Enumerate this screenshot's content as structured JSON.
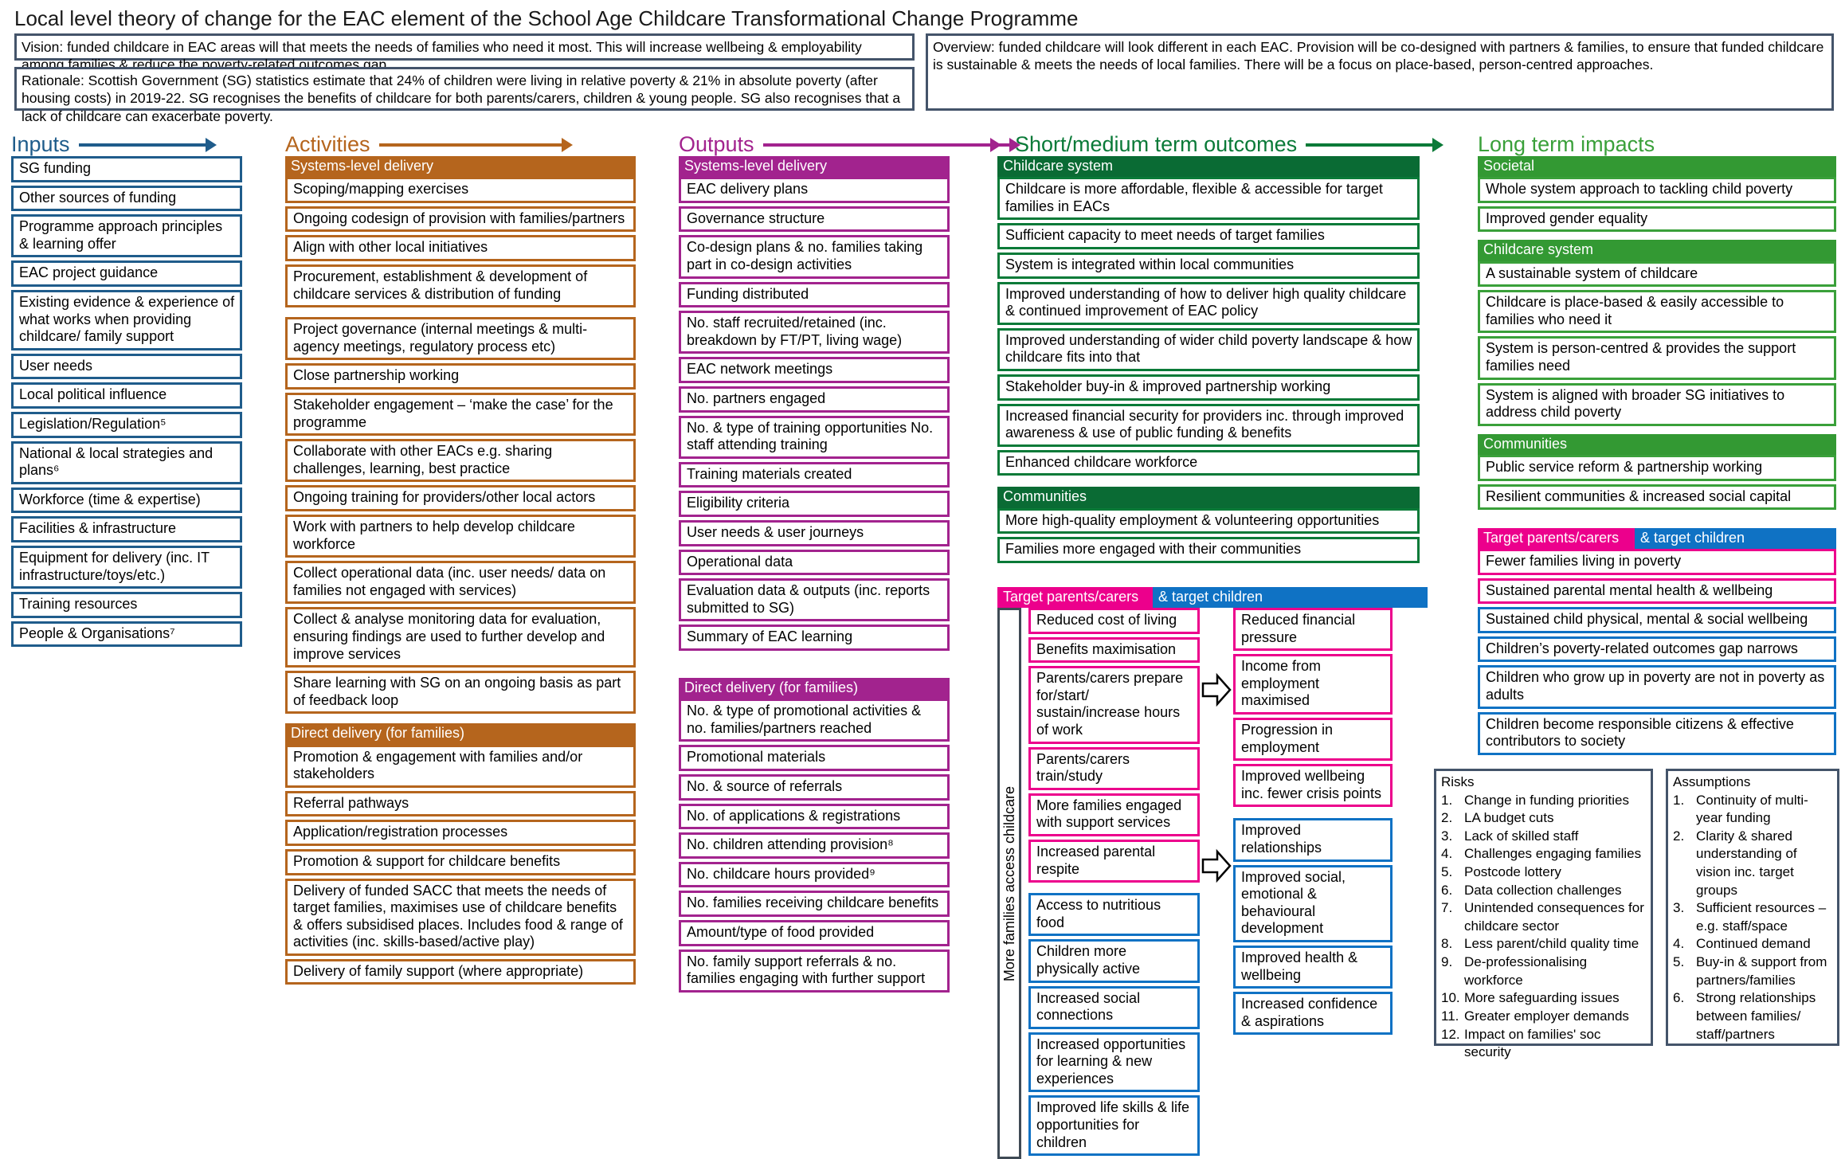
{
  "title": "Local level theory of change for the EAC element of the School Age Childcare Transformational Change Programme",
  "header": {
    "vision": "Vision: funded childcare in EAC areas will that meets the needs of families who need it most. This will increase wellbeing & employability among families & reduce the poverty-related outcomes gap.",
    "rationale": "Rationale: Scottish Government (SG) statistics estimate that 24% of children were living in relative poverty & 21% in absolute poverty (after housing costs) in 2019-22. SG recognises the benefits of childcare for both parents/carers, children & young people. SG also recognises that a lack of childcare can exacerbate poverty.",
    "overview": "Overview: funded childcare will look different in each EAC. Provision will be co-designed with partners & families, to ensure that funded childcare is sustainable & meets the needs of local families. There will be a focus on place-based, person-centred approaches."
  },
  "colors": {
    "inputs": "#1f5c8b",
    "activities": "#b5651d",
    "outputs": "#a2238e",
    "outcomes": "#0a7a38",
    "impacts": "#3aa03a",
    "parents": "#ec008c",
    "children": "#0f72c4",
    "frame": "#44546a"
  },
  "columns": {
    "inputs": {
      "heading": "Inputs",
      "items": [
        "SG funding",
        "Other sources of funding",
        "Programme approach principles & learning offer",
        "EAC project guidance",
        "Existing evidence & experience of what works when providing childcare/ family support",
        "User needs",
        "Local political influence",
        "Legislation/Regulation⁵",
        "National & local strategies and plans⁶",
        "Workforce (time & expertise)",
        "Facilities & infrastructure",
        "Equipment for delivery (inc. IT infrastructure/toys/etc.)",
        "Training resources",
        "People & Organisations⁷"
      ]
    },
    "activities": {
      "heading": "Activities",
      "groups": [
        {
          "caption": "Systems-level delivery",
          "items": [
            "Scoping/mapping exercises",
            "Ongoing codesign of provision with families/partners",
            "Align with other local initiatives",
            "Procurement, establishment & development of childcare services & distribution of funding"
          ]
        },
        {
          "caption": "",
          "items": [
            "Project governance (internal meetings & multi-agency meetings, regulatory process etc)",
            "Close partnership working",
            "Stakeholder engagement – ‘make the case’ for the programme",
            "Collaborate with other EACs e.g. sharing challenges, learning, best practice",
            "Ongoing training for providers/other local actors",
            "Work with partners to help develop childcare workforce",
            "Collect operational data (inc. user needs/ data on families not engaged with services)",
            "Collect & analyse monitoring data for evaluation, ensuring findings are used to further develop and improve services",
            "Share learning with SG on an ongoing basis as part of feedback loop"
          ]
        },
        {
          "caption": "Direct delivery (for families)",
          "items": [
            "Promotion & engagement with families and/or stakeholders",
            "Referral pathways",
            "Application/registration processes",
            "Promotion & support for childcare benefits",
            "Delivery of funded SACC that meets the needs of target families, maximises use of childcare benefits & offers subsidised places. Includes food & range of activities (inc. skills-based/active play)",
            "Delivery of family support (where appropriate)"
          ]
        }
      ]
    },
    "outputs": {
      "heading": "Outputs",
      "groups": [
        {
          "caption": "Systems-level delivery",
          "items": [
            "EAC delivery plans",
            "Governance structure",
            "Co-design plans & no. families taking part in co-design activities",
            "Funding distributed",
            "No. staff recruited/retained (inc. breakdown by FT/PT, living wage)",
            "EAC network meetings",
            "No. partners engaged",
            "No. & type of training opportunities No. staff attending training",
            "Training materials created",
            "Eligibility criteria",
            "User needs & user journeys",
            "Operational data",
            "Evaluation data & outputs (inc. reports submitted to SG)",
            "Summary of EAC learning"
          ]
        },
        {
          "caption": "Direct delivery (for families)",
          "items": [
            "No. & type of promotional activities & no. families/partners reached",
            "Promotional materials",
            "No. & source of referrals",
            "No. of applications & registrations",
            "No. children attending provision⁸",
            "No. childcare hours provided⁹",
            "No. families receiving childcare benefits",
            "Amount/type of food provided",
            "No. family support referrals & no. families engaging with further support"
          ]
        }
      ]
    },
    "outcomes": {
      "heading": "Short/medium term outcomes",
      "groups": [
        {
          "caption": "Childcare system",
          "items": [
            "Childcare is more affordable, flexible & accessible for target families in EACs",
            "Sufficient capacity to meet needs of target families",
            "System is integrated within local communities",
            "Improved understanding of how to deliver high quality childcare & continued improvement of EAC policy",
            "Improved understanding of wider child poverty landscape & how childcare fits into that",
            "Stakeholder buy-in & improved partnership working",
            "Increased financial security for providers inc. through improved awareness & use of public funding & benefits",
            "Enhanced childcare workforce"
          ]
        },
        {
          "caption": "Communities",
          "items": [
            "More high-quality employment & volunteering opportunities",
            "Families more engaged with their communities"
          ]
        }
      ],
      "target_band": {
        "left_caption": "Target parents/carers",
        "right_caption": "& target children",
        "vertical_label": "More families access childcare",
        "parents_group": {
          "pink_items": [
            "Reduced cost of living",
            "Benefits maximisation",
            "Parents/carers prepare for/start/ sustain/increase hours of work",
            "Parents/carers train/study",
            "More families engaged with support services",
            "Increased parental respite"
          ],
          "blue_items": [
            "Access to nutritious food",
            "Children more physically active",
            "Increased social connections",
            "Increased opportunities for learning & new experiences",
            "Improved life skills & life opportunities for children"
          ]
        },
        "children_group": {
          "pink_items": [
            "Reduced financial pressure",
            "Income from employment maximised",
            "Progression in employment",
            "Improved wellbeing inc. fewer crisis points"
          ],
          "blue_items": [
            "Improved relationships",
            "Improved social, emotional & behavioural development",
            "Improved health & wellbeing",
            "Increased confidence & aspirations"
          ]
        }
      }
    },
    "impacts": {
      "heading": "Long term impacts",
      "groups": [
        {
          "caption": "Societal",
          "items": [
            "Whole system approach to tackling child poverty",
            "Improved gender equality"
          ]
        },
        {
          "caption": "Childcare system",
          "items": [
            "A sustainable system of childcare",
            "Childcare is place-based & easily accessible to families who need it",
            "System is person-centred & provides the support families need",
            "System is aligned with broader SG initiatives to address child poverty"
          ]
        },
        {
          "caption": "Communities",
          "items": [
            "Public service reform & partnership working",
            "Resilient communities & increased social capital"
          ]
        }
      ],
      "target_band": {
        "left_caption": "Target parents/carers",
        "right_caption": "& target children",
        "pink_items": [
          "Fewer families living in poverty",
          "Sustained parental mental health & wellbeing"
        ],
        "blue_items": [
          "Sustained child physical, mental & social wellbeing",
          "Children’s poverty-related outcomes gap narrows",
          "Children who grow up in poverty are not in poverty as adults",
          "Children become responsible citizens & effective contributors to society"
        ]
      }
    }
  },
  "risks": {
    "title": "Risks",
    "items": [
      "Change in funding priorities",
      "LA budget cuts",
      "Lack of skilled staff",
      "Challenges engaging families",
      "Postcode lottery",
      "Data collection challenges",
      "Unintended consequences for childcare sector",
      "Less parent/child quality time",
      "De-professionalising workforce",
      "More safeguarding issues",
      "Greater employer demands",
      "Impact on families' soc security"
    ]
  },
  "assumptions": {
    "title": "Assumptions",
    "items": [
      "Continuity of multi-year funding",
      "Clarity & shared understanding of vision inc. target groups",
      "Sufficient resources – e.g. staff/space",
      "Continued demand",
      "Buy-in & support from partners/families",
      "Strong relationships between families/ staff/partners"
    ]
  }
}
